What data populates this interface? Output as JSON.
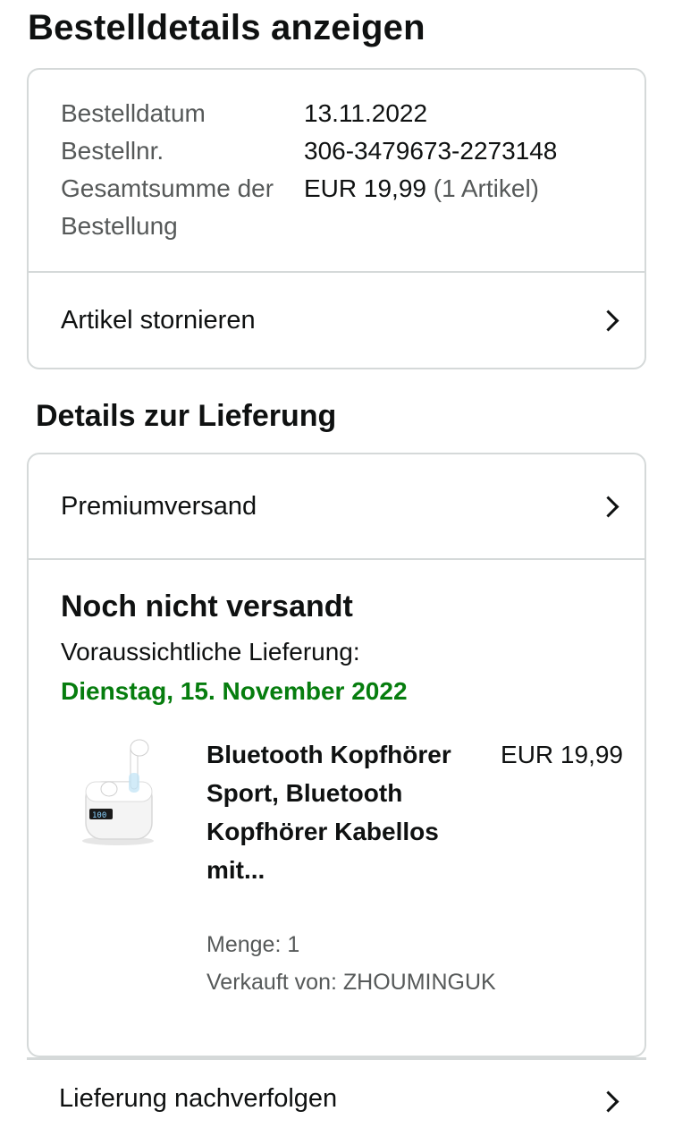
{
  "header": {
    "title": "Bestelldetails anzeigen"
  },
  "order": {
    "rows": [
      {
        "label": "Bestelldatum",
        "value": "13.11.2022"
      },
      {
        "label": "Bestellnr.",
        "value": "306-3479673-2273148"
      },
      {
        "label": "Gesamtsumme der Bestellung",
        "value": "EUR 19,99",
        "extra": "(1 Artikel)"
      }
    ],
    "cancel_label": "Artikel stornieren"
  },
  "delivery": {
    "section_title": "Details zur Lieferung",
    "shipping_label": "Premiumversand",
    "status": "Noch nicht versandt",
    "expected_label": "Voraussichtliche Lieferung:",
    "expected_date": "Dienstag, 15. November 2022",
    "product": {
      "title": "Bluetooth Kopfhörer Sport, Bluetooth Kopfhörer Kabellos mit...",
      "price": "EUR 19,99",
      "quantity": "Menge: 1",
      "seller": "Verkauft von: ZHOUMINGUK",
      "image_icon": "earbuds-image"
    },
    "date_color": "#067d0e"
  },
  "tracking": {
    "label": "Lieferung nachverfolgen"
  }
}
